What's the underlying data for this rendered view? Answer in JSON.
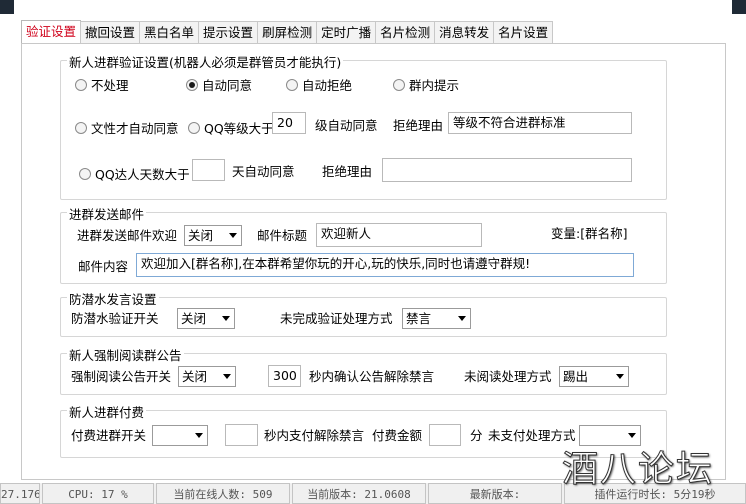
{
  "tabs": [
    "验证设置",
    "撤回设置",
    "黑白名单",
    "提示设置",
    "刷屏检测",
    "定时广播",
    "名片检测",
    "消息转发",
    "名片设置"
  ],
  "verify": {
    "title": "新人进群验证设置(机器人必须是群管员才能执行)",
    "radios": [
      "不处理",
      "自动同意",
      "自动拒绝",
      "群内提示"
    ],
    "female_auto": "文性才自动同意",
    "qq_level_label": "QQ等级大于",
    "qq_level_value": "20",
    "level_auto": "级自动同意",
    "reject_reason_label": "拒绝理由",
    "reject_reason_value": "等级不符合进群标准",
    "qq_days_label": "QQ达人天数大于",
    "qq_days_value": "",
    "days_auto": "天自动同意",
    "reject_reason_label2": "拒绝理由",
    "reject_reason_value2": ""
  },
  "mail": {
    "title": "进群发送邮件",
    "welcome_label": "进群发送邮件欢迎",
    "welcome_value": "关闭",
    "subject_label": "邮件标题",
    "subject_value": "欢迎新人",
    "var_label": "变量:[群名称]",
    "content_label": "邮件内容",
    "content_value": "欢迎加入[群名称],在本群希望你玩的开心,玩的快乐,同时也请遵守群规!"
  },
  "lurk": {
    "title": "防潜水发言设置",
    "switch_label": "防潜水验证开关",
    "switch_value": "关闭",
    "unfinished_label": "未完成验证处理方式",
    "unfinished_value": "禁言"
  },
  "notice": {
    "title": "新人强制阅读群公告",
    "switch_label": "强制阅读公告开关",
    "switch_value": "关闭",
    "seconds_value": "300",
    "seconds_label": "秒内确认公告解除禁言",
    "unread_label": "未阅读处理方式",
    "unread_value": "踢出"
  },
  "pay": {
    "title": "新人进群付费",
    "switch_label": "付费进群开关",
    "switch_value": "",
    "seconds_value": "",
    "seconds_label": "秒内支付解除禁言",
    "amount_label": "付费金额",
    "amount_value": "",
    "unit_label": "分",
    "unpaid_label": "未支付处理方式",
    "unpaid_value": ""
  },
  "status": {
    "c0": "27.176",
    "c1": "CPU: 17 %",
    "c2": "当前在线人数: 509",
    "c3": "当前版本: 21.0608",
    "c4": "最新版本:",
    "c5": "插件运行时长: 5分19秒"
  },
  "watermark": "酒八论坛"
}
